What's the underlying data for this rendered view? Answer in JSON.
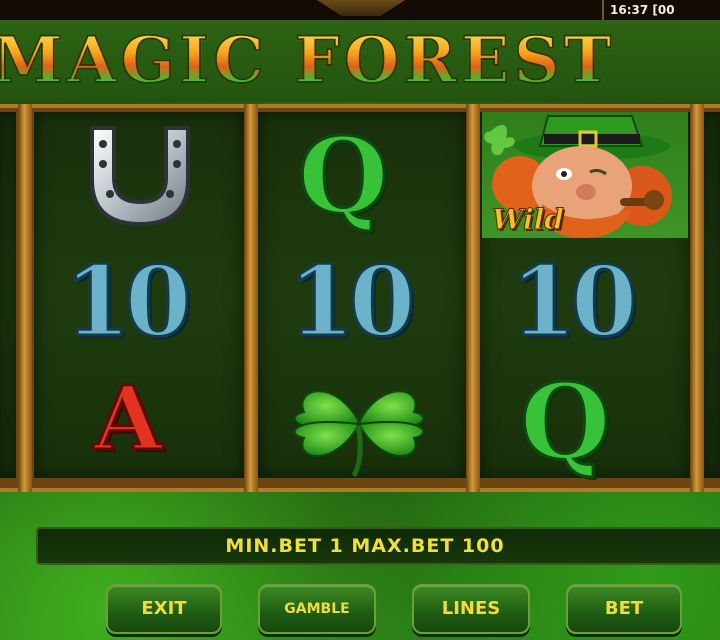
{
  "status": {
    "clock": "16:37 [00"
  },
  "game": {
    "title": "MAGIC FOREST"
  },
  "reels": [
    {
      "symbols": [
        "horseshoe",
        "10",
        "A"
      ]
    },
    {
      "symbols": [
        "Q",
        "10",
        "four-leaf-clover"
      ]
    },
    {
      "symbols": [
        "Wild",
        "10",
        "Q"
      ]
    }
  ],
  "symbols": {
    "ten": "10",
    "queen": "Q",
    "ace": "A",
    "wild": "Wild"
  },
  "info": {
    "bet_limits": "MIN.BET 1 MAX.BET 100"
  },
  "buttons": {
    "exit": "EXIT",
    "gamble": "GAMBLE",
    "lines": "LINES",
    "bet": "BET"
  },
  "colors": {
    "button_text": "#f1dc3b",
    "info_text": "#f2df3a",
    "ten_blue": "#6cb3c9",
    "queen_green": "#38c23a",
    "ace_red": "#e3321f"
  }
}
